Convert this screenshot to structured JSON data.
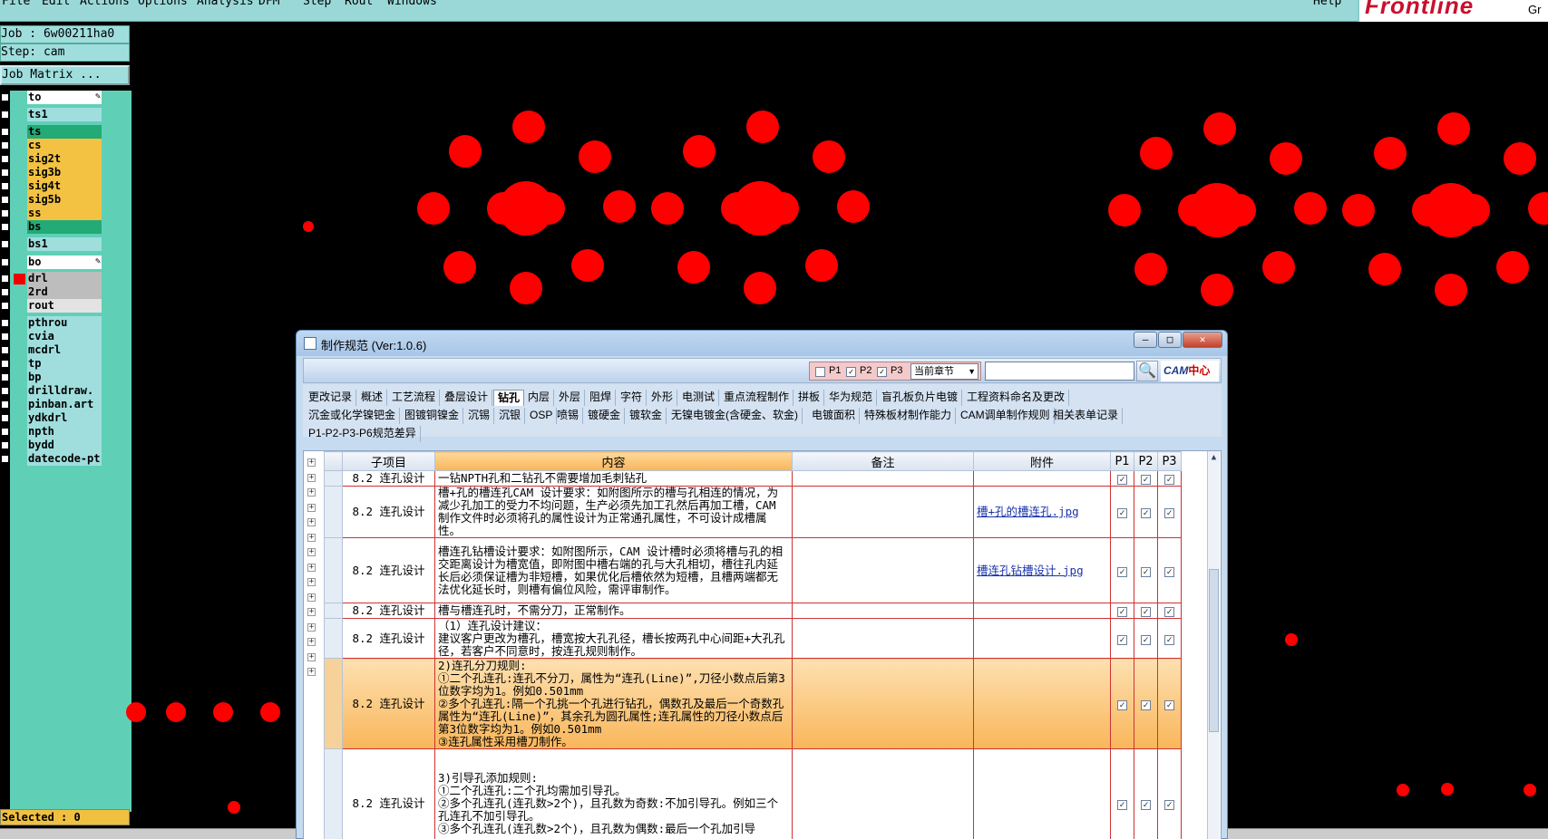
{
  "menubar": {
    "items": [
      "File",
      "Edit",
      "Actions",
      "Options",
      "Analysis",
      "DFM",
      "Step",
      "Rout",
      "Windows"
    ],
    "help": "Help",
    "logo": "Frontline",
    "logo_suffix": "Gr"
  },
  "job": {
    "label": "Job : 6w00211ha0",
    "step": "Step: cam",
    "matrix_button": "Job Matrix ..."
  },
  "layers": [
    {
      "name": "to",
      "color": "#ffffff",
      "pen": true
    },
    {
      "name": "ts1",
      "color": "#a0dede"
    },
    {
      "name": "ts",
      "color": "#22aa77"
    },
    {
      "name": "cs",
      "color": "#f3c242"
    },
    {
      "name": "sig2t",
      "color": "#f3c242"
    },
    {
      "name": "sig3b",
      "color": "#f3c242"
    },
    {
      "name": "sig4t",
      "color": "#f3c242"
    },
    {
      "name": "sig5b",
      "color": "#f3c242"
    },
    {
      "name": "ss",
      "color": "#f3c242"
    },
    {
      "name": "bs",
      "color": "#22aa77"
    },
    {
      "name": "bs1",
      "color": "#a0dede"
    },
    {
      "name": "bo",
      "color": "#ffffff",
      "pen": true
    },
    {
      "name": "drl",
      "color": "#bdbdbd",
      "active": true
    },
    {
      "name": "2rd",
      "color": "#bdbdbd"
    },
    {
      "name": "rout",
      "color": "#e3e3e3"
    },
    {
      "name": "pthrou",
      "color": "#a0dede"
    },
    {
      "name": "cvia",
      "color": "#a0dede"
    },
    {
      "name": "mcdrl",
      "color": "#a0dede"
    },
    {
      "name": "tp",
      "color": "#a0dede"
    },
    {
      "name": "bp",
      "color": "#a0dede"
    },
    {
      "name": "drilldraw.",
      "color": "#a0dede"
    },
    {
      "name": "pinban.art",
      "color": "#a0dede"
    },
    {
      "name": "ydkdrl",
      "color": "#a0dede"
    },
    {
      "name": "npth",
      "color": "#a0dede"
    },
    {
      "name": "bydd",
      "color": "#a0dede"
    },
    {
      "name": "datecode-pt",
      "color": "#a0dede"
    }
  ],
  "status": {
    "selected": "Selected : 0"
  },
  "colors": {
    "copper": "#ff0000",
    "background": "#000000",
    "panel": "#5fd0b6"
  },
  "dialog": {
    "title": "制作规范 (Ver:1.0.6)",
    "window_buttons": [
      "—",
      "□",
      "✕"
    ],
    "filters": [
      {
        "label": "P1",
        "checked": false
      },
      {
        "label": "P2",
        "checked": true
      },
      {
        "label": "P3",
        "checked": true
      }
    ],
    "scope_select": "当前章节",
    "search_value": "",
    "search_icon": "magnifier-icon",
    "cam_logo": "CAM",
    "cam_logo_zh": "中心",
    "tabs_row1": [
      "更改记录",
      "概述",
      "工艺流程",
      "叠层设计",
      "钻孔",
      "内层",
      "外层",
      "阻焊",
      "字符",
      "外形",
      "电测试",
      "重点流程制作",
      "拼板",
      "华为规范",
      "盲孔板负片电镀",
      "工程资料命名及更改"
    ],
    "tabs_row2": [
      "沉金或化学镍钯金",
      "图镀铜镍金",
      "沉锡",
      "沉银",
      "OSP",
      "喷锡",
      "镀硬金",
      "镀软金",
      "无镍电镀金(含硬金、软金)",
      "电镀面积",
      "特殊板材制作能力",
      "CAM调单制作规则",
      "相关表单记录"
    ],
    "tabs_row3": [
      "P1-P2-P3-P6规范差异"
    ],
    "active_tab": "钻孔",
    "columns": [
      "子项目",
      "内容",
      "备注",
      "附件",
      "P1",
      "P2",
      "P3"
    ],
    "rows": [
      {
        "sub": "8.2 连孔设计",
        "content": "一钻NPTH孔和二钻孔不需要增加毛刺钻孔",
        "note": "",
        "attachment": "",
        "p": [
          "✓",
          "✓",
          "✓"
        ]
      },
      {
        "sub": "8.2 连孔设计",
        "content": "槽+孔的槽连孔CAM 设计要求：如附图所示的槽与孔相连的情况，为减少孔加工的受力不均问题，生产必须先加工孔然后再加工槽，CAM 制作文件时必须将孔的属性设计为正常通孔属性，不可设计成槽属性。",
        "note": "",
        "attachment": "槽+孔的槽连孔.jpg",
        "p": [
          "✓",
          "✓",
          "✓"
        ]
      },
      {
        "sub": "8.2 连孔设计",
        "content": "槽连孔钻槽设计要求：如附图所示，CAM 设计槽时必须将槽与孔的相交距离设计为槽宽值，即附图中槽右端的孔与大孔相切，槽往孔内延长后必须保证槽为非短槽，如果优化后槽依然为短槽，且槽两端都无法优化延长时，则槽有偏位风险，需评审制作。",
        "note": "",
        "attachment": "槽连孔钻槽设计.jpg",
        "p": [
          "✓",
          "✓",
          "✓"
        ]
      },
      {
        "sub": "8.2 连孔设计",
        "content": "槽与槽连孔时，不需分刀，正常制作。",
        "note": "",
        "attachment": "",
        "p": [
          "✓",
          "✓",
          "✓"
        ]
      },
      {
        "sub": "8.2 连孔设计",
        "content": "（1）连孔设计建议：\n建议客户更改为槽孔，槽宽按大孔孔径，槽长按两孔中心间距+大孔孔径，若客户不同意时，按连孔规则制作。",
        "note": "",
        "attachment": "",
        "p": [
          "✓",
          "✓",
          "✓"
        ]
      },
      {
        "sub": "8.2 连孔设计",
        "content": "2)连孔分刀规则:\n①二个孔连孔:连孔不分刀，属性为“连孔(Line)”,刀径小数点后第3位数字均为1。例如0.501mm\n②多个孔连孔:隔一个孔挑一个孔进行钻孔，偶数孔及最后一个奇数孔属性为“连孔(Line)”，其余孔为圆孔属性;连孔属性的刀径小数点后第3位数字均为1。例如0.501mm\n③连孔属性采用槽刀制作。",
        "note": "",
        "attachment": "",
        "p": [
          "✓",
          "✓",
          "✓"
        ],
        "selected": true
      },
      {
        "sub": "8.2 连孔设计",
        "content": "3)引导孔添加规则:\n①二个孔连孔:二个孔均需加引导孔。\n②多个孔连孔(连孔数>2个)，且孔数为奇数:不加引导孔。例如三个孔连孔不加引导孔。\n③多个孔连孔(连孔数>2个)，且孔数为偶数:最后一个孔加引导",
        "note": "",
        "attachment": "",
        "p": [
          "✓",
          "✓",
          "✓"
        ]
      }
    ]
  }
}
